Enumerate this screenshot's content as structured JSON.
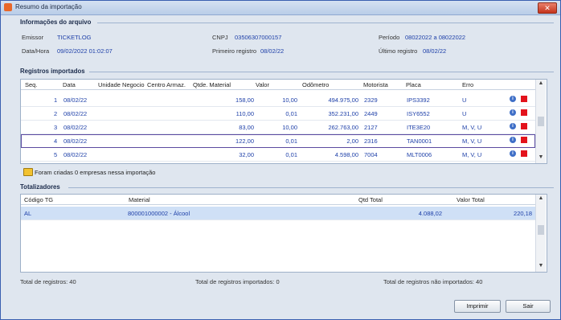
{
  "window": {
    "title": "Resumo da importação",
    "close": "✕"
  },
  "info": {
    "section_title": "Informações do arquivo",
    "emissor_label": "Emissor",
    "emissor_value": "TICKETLOG",
    "cnpj_label": "CNPJ",
    "cnpj_value": "03506307000157",
    "periodo_label": "Período",
    "periodo_value": "08022022 a 08022022",
    "datahora_label": "Data/Hora",
    "datahora_value": "09/02/2022 01:02:07",
    "primeiro_label": "Primeiro registro",
    "primeiro_value": "08/02/22",
    "ultimo_label": "Último registro",
    "ultimo_value": "08/02/22"
  },
  "registros": {
    "section_title": "Registros importados",
    "columns": [
      "Seq.",
      "Data",
      "Unidade Negocio",
      "Centro Armaz.",
      "Qtde. Material",
      "Valor",
      "Odômetro",
      "Motorista",
      "Placa",
      "Erro"
    ],
    "rows": [
      {
        "seq": "1",
        "data": "08/02/22",
        "qtde": "158,00",
        "valor": "10,00",
        "odometro": "494.975,00",
        "motorista": "2329",
        "placa": "IPS3392",
        "erro": "U"
      },
      {
        "seq": "2",
        "data": "08/02/22",
        "qtde": "110,00",
        "valor": "0,01",
        "odometro": "352.231,00",
        "motorista": "2449",
        "placa": "ISY6552",
        "erro": "U"
      },
      {
        "seq": "3",
        "data": "08/02/22",
        "qtde": "83,00",
        "valor": "10,00",
        "odometro": "262.763,00",
        "motorista": "2127",
        "placa": "ITE3E20",
        "erro": "M, V, U"
      },
      {
        "seq": "4",
        "data": "08/02/22",
        "qtde": "122,00",
        "valor": "0,01",
        "odometro": "2,00",
        "motorista": "2316",
        "placa": "TAN0001",
        "erro": "M, V, U"
      },
      {
        "seq": "5",
        "data": "08/02/22",
        "qtde": "32,00",
        "valor": "0,01",
        "odometro": "4.598,00",
        "motorista": "7004",
        "placa": "MLT0006",
        "erro": "M, V, U"
      }
    ],
    "note": "Foram criadas 0 empresas nessa importação"
  },
  "totalizadores": {
    "section_title": "Totalizadores",
    "columns": [
      "Código TG",
      "Material",
      "Qtd Total",
      "Valor Total"
    ],
    "rows": [
      {
        "codigo": "AL",
        "material": "800001000002 - Álcool",
        "qtd": "4.088,02",
        "valor": "220,18"
      }
    ]
  },
  "footer": {
    "total": "Total de registros: 40",
    "importados": "Total de registros importados: 0",
    "nao_importados": "Total de registros não importados: 40"
  },
  "buttons": {
    "imprimir": "Imprimir",
    "sair": "Sair"
  },
  "icons": {
    "info": "info-icon",
    "error": "error-flag-icon",
    "warning": "warning-folder-icon"
  }
}
